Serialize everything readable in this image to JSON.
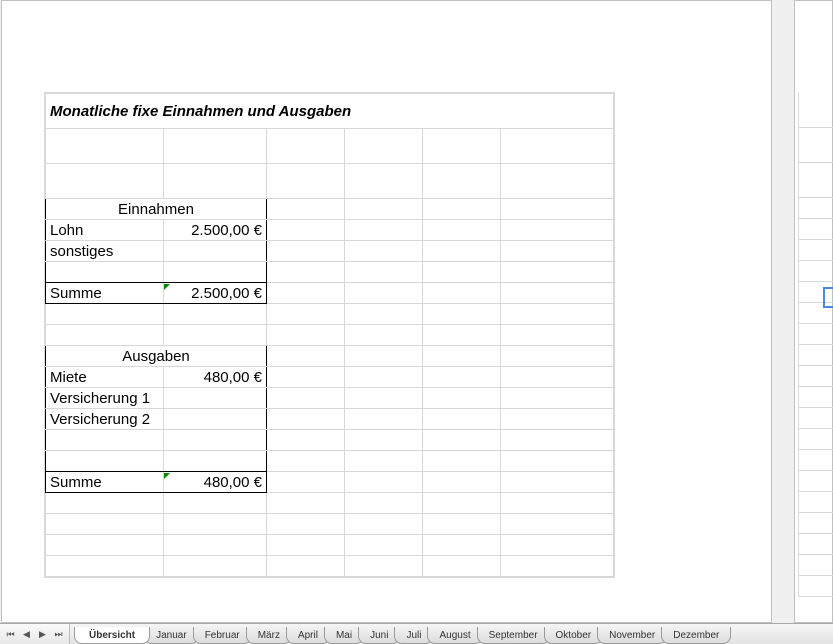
{
  "title": "Monatliche fixe Einnahmen und Ausgaben",
  "einnahmen": {
    "header": "Einnahmen",
    "rows": [
      {
        "label": "Lohn",
        "value": "2.500,00 €"
      },
      {
        "label": "sonstiges",
        "value": ""
      }
    ],
    "sum_label": "Summe",
    "sum_value": "2.500,00 €"
  },
  "ausgaben": {
    "header": "Ausgaben",
    "rows": [
      {
        "label": "Miete",
        "value": "480,00 €"
      },
      {
        "label": "Versicherung 1",
        "value": ""
      },
      {
        "label": "Versicherung 2",
        "value": ""
      }
    ],
    "sum_label": "Summe",
    "sum_value": "480,00 €"
  },
  "tabs": {
    "active": "Übersicht",
    "items": [
      "Übersicht",
      "Januar",
      "Februar",
      "März",
      "April",
      "Mai",
      "Juni",
      "Juli",
      "August",
      "September",
      "Oktober",
      "November",
      "Dezember"
    ]
  }
}
